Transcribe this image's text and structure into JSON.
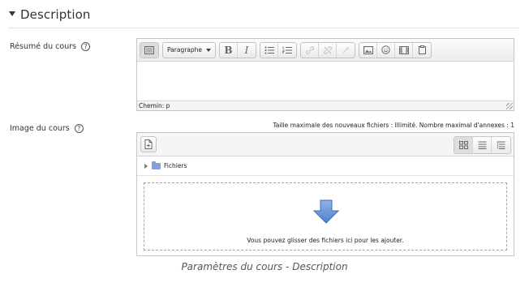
{
  "section": {
    "title": "Description"
  },
  "summary_field": {
    "label": "Résumé du cours",
    "help_icon": "question-circle-icon",
    "help_glyph": "?"
  },
  "editor": {
    "toolbar": {
      "toggle_icon": "toolbar-toggle-icon",
      "paragraph_select": "Paragraphe",
      "bold": "B",
      "italic": "I",
      "unordered_list_icon": "bullet-list-icon",
      "ordered_list_icon": "numbered-list-icon",
      "link_icon": "link-icon",
      "unlink_icon": "unlink-icon",
      "anchor_icon": "anchor-icon",
      "image_icon": "image-icon",
      "emoticon_icon": "smiley-icon",
      "media_icon": "film-icon",
      "paste_icon": "clipboard-icon"
    },
    "status_path": "Chemin: p"
  },
  "image_field": {
    "label": "Image du cours",
    "help_icon": "question-circle-icon",
    "help_glyph": "?",
    "limits": "Taille maximale des nouveaux fichiers : Illimité. Nombre maximal d'annexes : 1",
    "add_icon": "add-file-icon",
    "views": [
      "grid-view-icon",
      "list-view-icon",
      "tree-view-icon"
    ],
    "folder_name": "Fichiers",
    "drop_text": "Vous pouvez glisser des fichiers ici pour les ajouter."
  },
  "caption": "Paramètres du cours - Description",
  "colors": {
    "folder": "#7ea3d4",
    "drop_arrow": "#5b8fd6"
  }
}
